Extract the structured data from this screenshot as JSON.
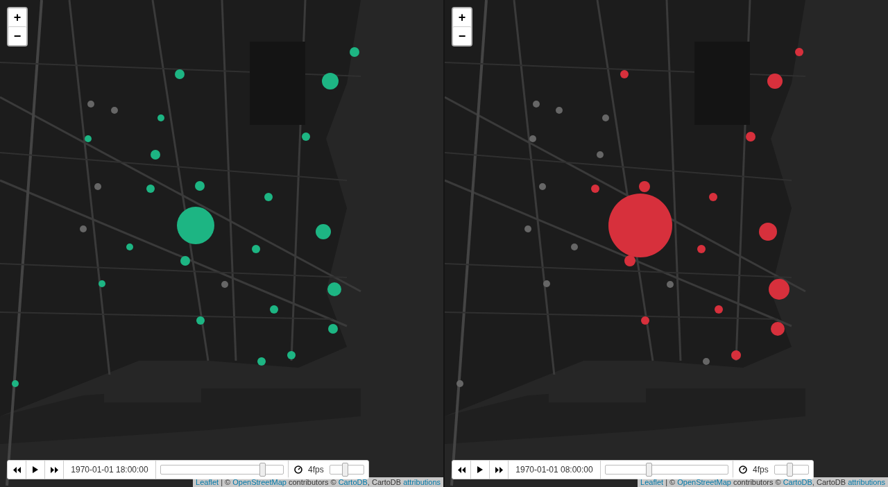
{
  "maps": [
    {
      "zoom": {
        "in": "+",
        "out": "−"
      },
      "markers": [
        {
          "color": "#1db583"
        },
        {
          "color": "#1db583"
        },
        {
          "color": "#1db583"
        },
        {
          "color": "#1db583"
        },
        {
          "color": "#1db583"
        },
        {
          "color": "#1db583"
        },
        {
          "color": "#1db583"
        },
        {
          "color": "#1db583"
        },
        {
          "color": "#1db583"
        },
        {
          "color": "#1db583"
        },
        {
          "color": "#1db583"
        },
        {
          "color": "#1db583"
        },
        {
          "color": "#1db583"
        },
        {
          "color": "#1db583"
        },
        {
          "color": "#1db583"
        },
        {
          "color": "#1db583"
        },
        {
          "color": "#1db583"
        },
        {
          "color": "#1db583"
        },
        {
          "color": "#1db583"
        },
        {
          "color": "#1db583"
        },
        {
          "color": "#1db583"
        },
        {
          "color": "#1db583"
        },
        {
          "color": "#1db583"
        },
        {
          "color": "#666666"
        },
        {
          "color": "#666666"
        },
        {
          "color": "#666666"
        },
        {
          "color": "#666666"
        },
        {
          "color": "#666666"
        }
      ],
      "player": {
        "time": "1970-01-01 18:00:00",
        "time_slider": {
          "level": 0.83
        },
        "fps": "4fps",
        "fps_slider": {
          "level": 0.45
        }
      },
      "attribution": [
        {
          "kind": "link",
          "text": "Leaflet"
        },
        {
          "kind": "text",
          "text": " | © "
        },
        {
          "kind": "link",
          "text": "OpenStreetMap"
        },
        {
          "kind": "text",
          "text": " contributors © "
        },
        {
          "kind": "link",
          "text": "CartoDB"
        },
        {
          "kind": "text",
          "text": ", CartoDB "
        },
        {
          "kind": "link",
          "text": "attributions"
        }
      ]
    },
    {
      "zoom": {
        "in": "+",
        "out": "−"
      },
      "markers": [
        {
          "color": "#d7303c"
        },
        {
          "color": "#d7303c"
        },
        {
          "color": "#d7303c"
        },
        {
          "color": "#d7303c"
        },
        {
          "color": "#d7303c"
        },
        {
          "color": "#d7303c"
        },
        {
          "color": "#d7303c"
        },
        {
          "color": "#d7303c"
        },
        {
          "color": "#d7303c"
        },
        {
          "color": "#d7303c"
        },
        {
          "color": "#d7303c"
        },
        {
          "color": "#d7303c"
        },
        {
          "color": "#d7303c"
        },
        {
          "color": "#d7303c"
        },
        {
          "color": "#d7303c"
        },
        {
          "color": "#d7303c"
        },
        {
          "color": "#666666"
        },
        {
          "color": "#666666"
        },
        {
          "color": "#666666"
        },
        {
          "color": "#666666"
        },
        {
          "color": "#666666"
        },
        {
          "color": "#666666"
        },
        {
          "color": "#666666"
        },
        {
          "color": "#666666"
        },
        {
          "color": "#666666"
        },
        {
          "color": "#666666"
        },
        {
          "color": "#666666"
        },
        {
          "color": "#666666"
        }
      ],
      "player": {
        "time": "1970-01-01 08:00:00",
        "time_slider": {
          "level": 0.35
        },
        "fps": "4fps",
        "fps_slider": {
          "level": 0.45
        }
      },
      "attribution": [
        {
          "kind": "link",
          "text": "Leaflet"
        },
        {
          "kind": "text",
          "text": " | © "
        },
        {
          "kind": "link",
          "text": "OpenStreetMap"
        },
        {
          "kind": "text",
          "text": " contributors © "
        },
        {
          "kind": "link",
          "text": "CartoDB"
        },
        {
          "kind": "text",
          "text": ", CartoDB "
        },
        {
          "kind": "link",
          "text": "attributions"
        }
      ]
    }
  ]
}
